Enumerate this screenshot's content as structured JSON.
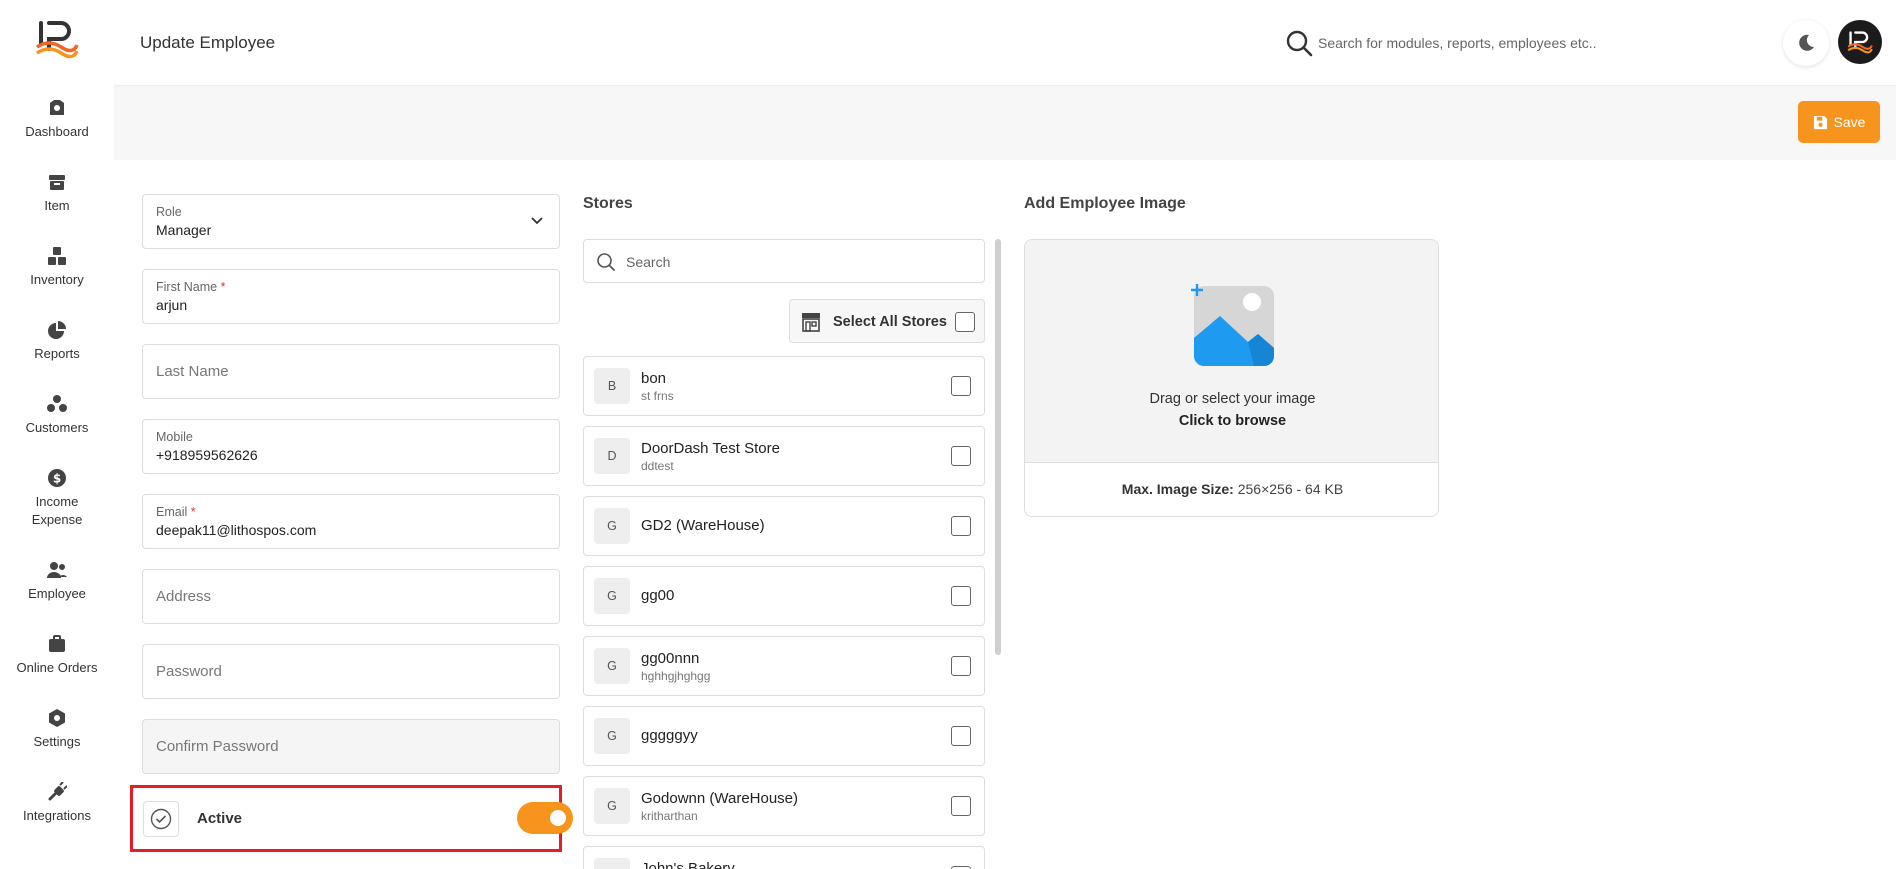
{
  "sidebar": {
    "items": [
      {
        "label": "Dashboard",
        "icon": "dashboard-icon"
      },
      {
        "label": "Item",
        "icon": "item-icon"
      },
      {
        "label": "Inventory",
        "icon": "inventory-icon"
      },
      {
        "label": "Reports",
        "icon": "reports-icon"
      },
      {
        "label": "Customers",
        "icon": "customers-icon"
      },
      {
        "label": "Income Expense",
        "icon": "income-expense-icon"
      },
      {
        "label": "Employee",
        "icon": "employee-icon"
      },
      {
        "label": "Online Orders",
        "icon": "online-orders-icon"
      },
      {
        "label": "Settings",
        "icon": "settings-icon"
      },
      {
        "label": "Integrations",
        "icon": "integrations-icon"
      }
    ]
  },
  "header": {
    "title": "Update Employee",
    "search_placeholder": "Search for modules, reports, employees etc.."
  },
  "toolbar": {
    "save_label": "Save"
  },
  "form": {
    "role": {
      "label": "Role",
      "value": "Manager"
    },
    "first_name": {
      "label": "First Name",
      "required": "*",
      "value": "arjun"
    },
    "last_name": {
      "placeholder": "Last Name"
    },
    "mobile": {
      "label": "Mobile",
      "value": "+918959562626"
    },
    "email": {
      "label": "Email",
      "required": "*",
      "value": "deepak11@lithospos.com"
    },
    "address": {
      "placeholder": "Address"
    },
    "password": {
      "placeholder": "Password"
    },
    "confirm_password": {
      "placeholder": "Confirm Password"
    },
    "active": {
      "label": "Active",
      "enabled": true
    }
  },
  "stores": {
    "title": "Stores",
    "search_placeholder": "Search",
    "select_all_label": "Select All Stores",
    "items": [
      {
        "initial": "B",
        "name": "bon",
        "sub": "st frns"
      },
      {
        "initial": "D",
        "name": "DoorDash Test Store",
        "sub": "ddtest"
      },
      {
        "initial": "G",
        "name": "GD2 (WareHouse)",
        "sub": ""
      },
      {
        "initial": "G",
        "name": "gg00",
        "sub": ""
      },
      {
        "initial": "G",
        "name": "gg00nnn",
        "sub": "hghhgjhghgg"
      },
      {
        "initial": "G",
        "name": "gggggyy",
        "sub": ""
      },
      {
        "initial": "G",
        "name": "Godownn (WareHouse)",
        "sub": "kritharthan"
      },
      {
        "initial": "J",
        "name": "John's Bakery",
        "sub": ""
      }
    ]
  },
  "image_upload": {
    "title": "Add Employee Image",
    "drag_text": "Drag or select your image",
    "browse_text": "Click to browse",
    "size_label": "Max. Image Size:",
    "size_value": "256×256 - 64 KB"
  },
  "colors": {
    "accent": "#f7941d",
    "highlight_border": "#e81c24",
    "image_blue": "#1e9bf0"
  }
}
